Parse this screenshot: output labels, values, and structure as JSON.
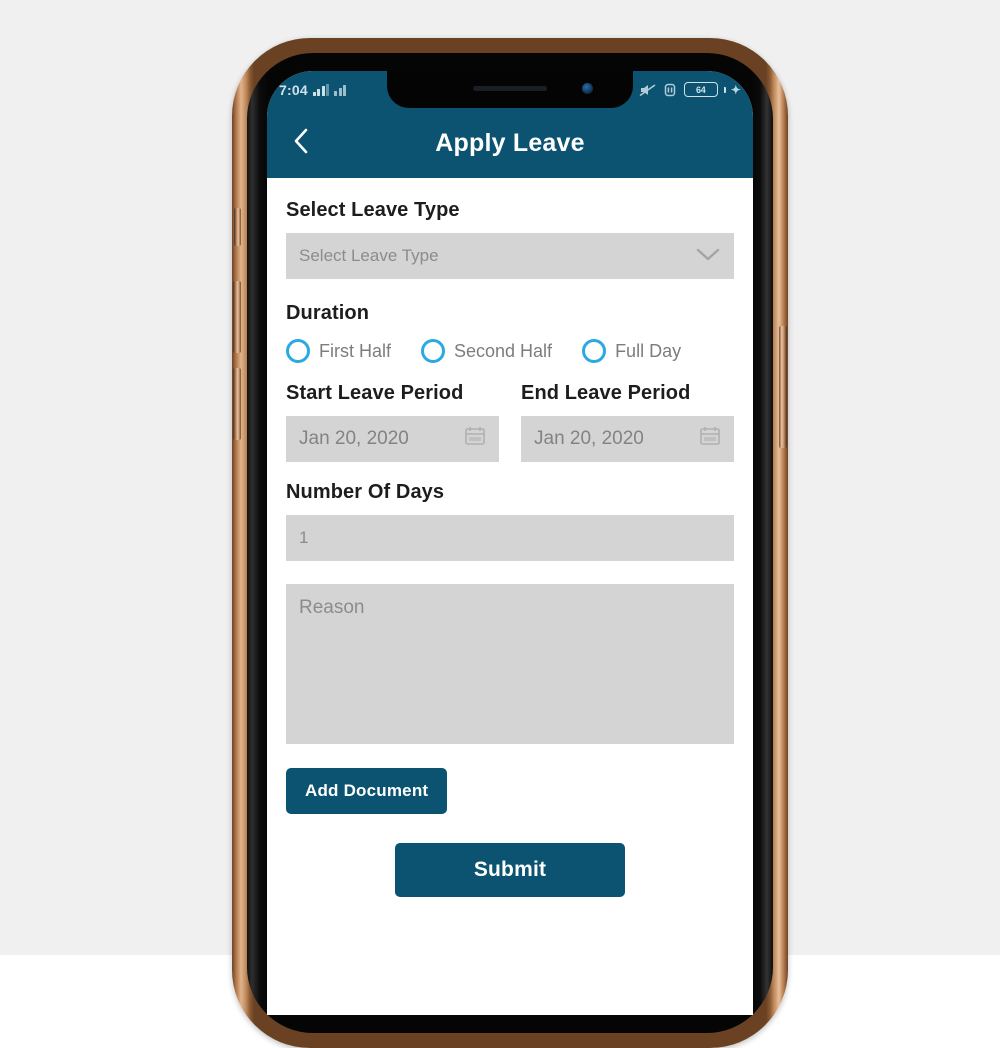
{
  "device": {
    "frame_color": "#b0764a",
    "bezel_color": "#050505"
  },
  "status_bar": {
    "time": "7:04",
    "signal_icon": "signal-bars-icon",
    "signal_icon_2": "signal-bars-secondary-icon",
    "mute_icon": "volume-mute-icon",
    "vibrate_icon": "vibrate-icon",
    "battery_level": "64",
    "charging_icon": "charging-bolt-icon"
  },
  "app_bar": {
    "back_icon": "chevron-left-icon",
    "title": "Apply Leave",
    "background_color": "#0b5370"
  },
  "form": {
    "leave_type": {
      "label": "Select Leave Type",
      "placeholder": "Select Leave Type",
      "value": "",
      "dropdown_icon": "chevron-down-icon"
    },
    "duration": {
      "label": "Duration",
      "options": [
        {
          "label": "First Half",
          "selected": false
        },
        {
          "label": "Second Half",
          "selected": false
        },
        {
          "label": "Full Day",
          "selected": false
        }
      ],
      "radio_color": "#2aa9e3"
    },
    "start_period": {
      "label": "Start Leave Period",
      "value": "Jan 20, 2020",
      "calendar_icon": "calendar-icon"
    },
    "end_period": {
      "label": "End Leave Period",
      "value": "Jan 20, 2020",
      "calendar_icon": "calendar-icon"
    },
    "number_of_days": {
      "label": "Number Of Days",
      "value": "1"
    },
    "reason": {
      "placeholder": "Reason",
      "value": ""
    },
    "add_document_button": "Add Document",
    "submit_button": "Submit",
    "field_background_color": "#d4d4d4"
  }
}
